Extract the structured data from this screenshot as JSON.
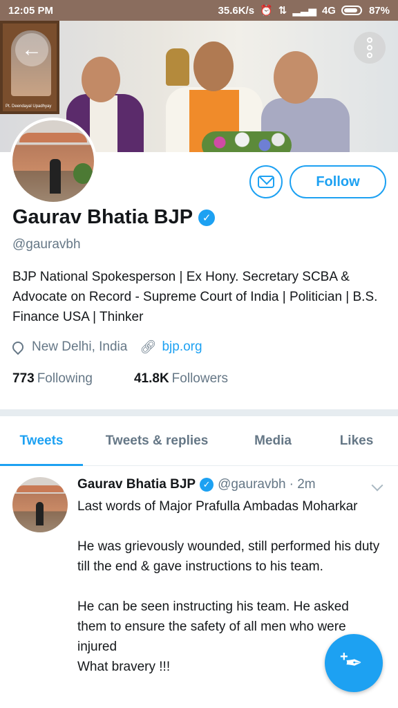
{
  "status_bar": {
    "time": "12:05 PM",
    "network_speed": "35.6K/s",
    "network_type": "4G",
    "battery": "87%"
  },
  "banner": {
    "portrait_caption": "Pt. Deendayal Upadhyay"
  },
  "profile": {
    "name": "Gaurav Bhatia BJP",
    "handle": "@gauravbh",
    "bio": "BJP National Spokesperson | Ex Hony. Secretary SCBA & Advocate on Record - Supreme Court of India  | Politician | B.S. Finance USA | Thinker",
    "location": "New Delhi, India",
    "website": "bjp.org",
    "following_count": "773",
    "following_label": "Following",
    "followers_count": "41.8K",
    "followers_label": "Followers",
    "follow_label": "Follow"
  },
  "tabs": [
    {
      "label": "Tweets",
      "active": true
    },
    {
      "label": "Tweets & replies",
      "active": false
    },
    {
      "label": "Media",
      "active": false
    },
    {
      "label": "Likes",
      "active": false
    }
  ],
  "tweet": {
    "name": "Gaurav Bhatia BJP",
    "handle": "@gauravbh",
    "time": "· 2m",
    "text": "Last words of Major Prafulla Ambadas Moharkar\n\nHe was grievously wounded, still performed his duty till the end & gave instructions to his team.\n\nHe can be seen instructing his team. He asked them to ensure the safety of all men who were injured\nWhat bravery !!!"
  },
  "colors": {
    "accent": "#1da1f2",
    "status_bar": "#8a6d5e",
    "secondary_text": "#657786"
  }
}
